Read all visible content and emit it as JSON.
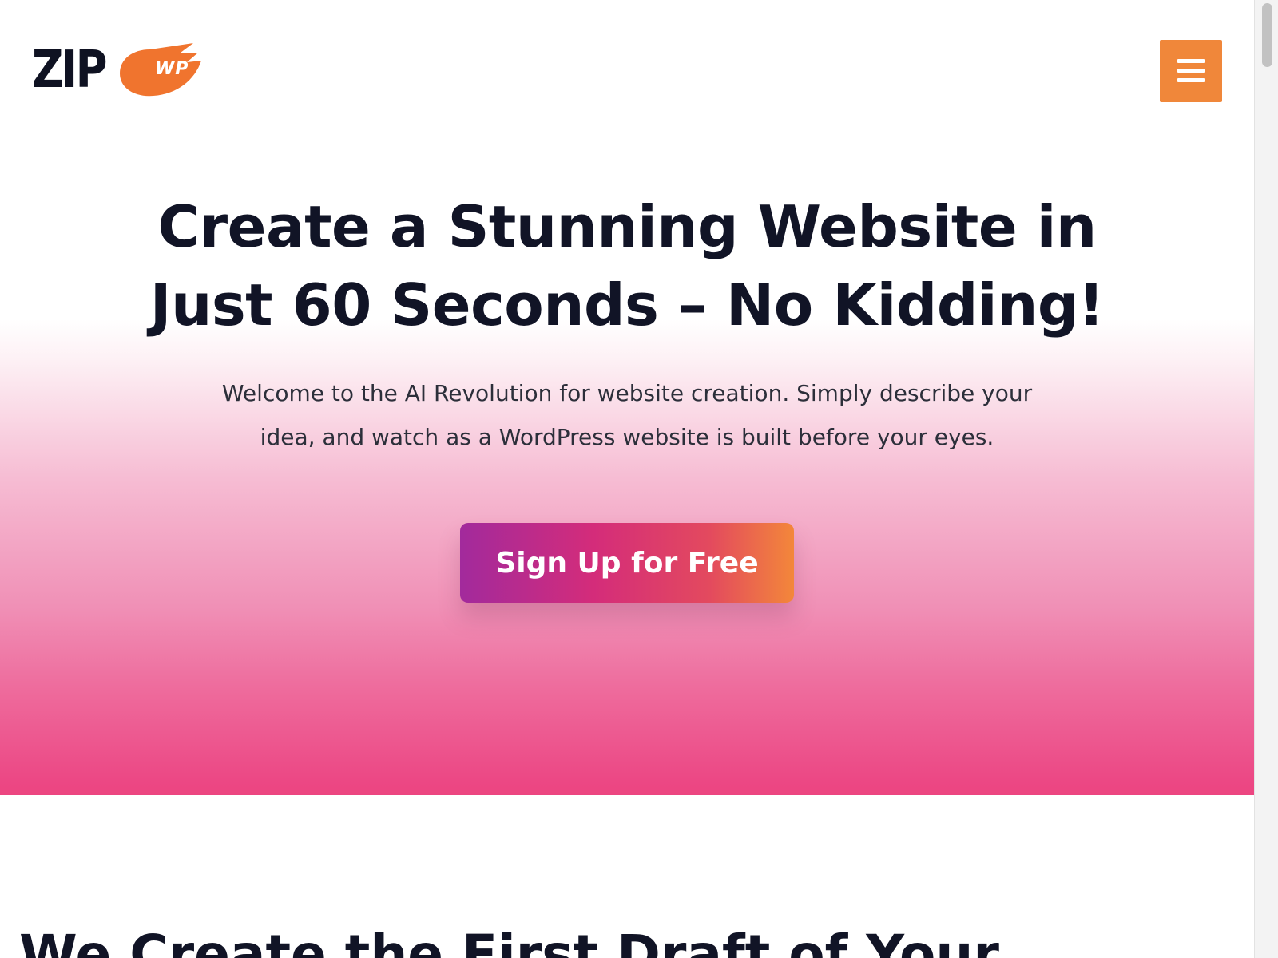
{
  "brand": {
    "logo_text": "ZIP",
    "logo_badge": "WP",
    "accent_color": "#f0873a"
  },
  "header": {
    "menu_icon": "hamburger-menu-icon"
  },
  "hero": {
    "title_line1": "Create a Stunning Website in",
    "title_line2": "Just 60 Seconds – No Kidding!",
    "subtitle_line1": "Welcome to the AI Revolution for website creation. Simply describe your",
    "subtitle_line2": "idea, and watch as a WordPress website is built before your eyes.",
    "cta_label": "Sign Up for Free"
  },
  "next_section": {
    "title": "We Create the First Draft of Your"
  }
}
